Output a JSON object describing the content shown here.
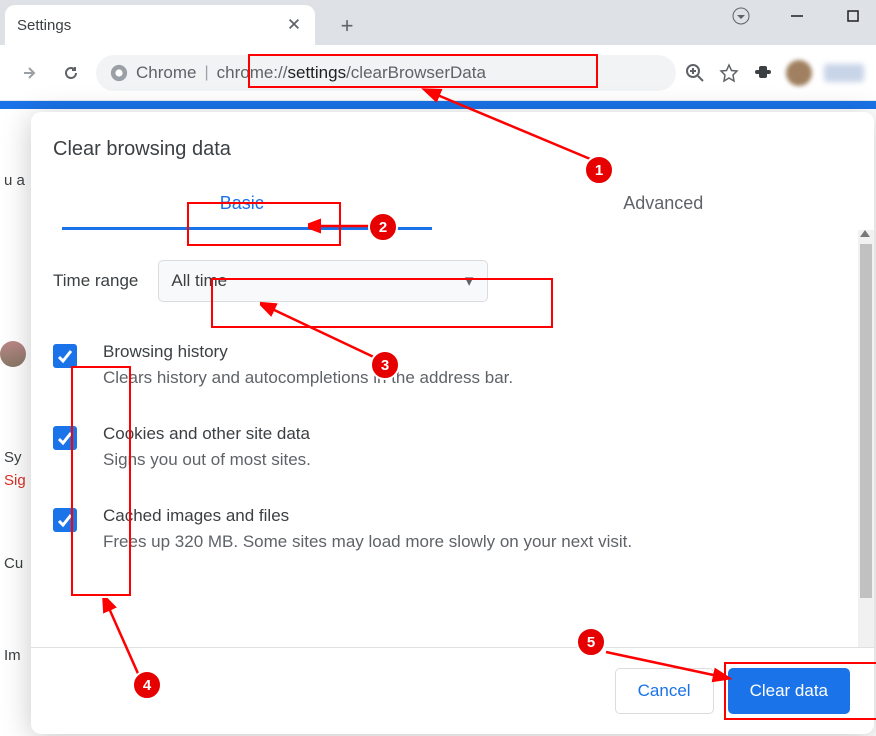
{
  "tab_title": "Settings",
  "url_label": "Chrome",
  "url": "chrome://settings/clearBrowserData",
  "dialog": {
    "title": "Clear browsing data",
    "tabs": {
      "basic": "Basic",
      "advanced": "Advanced"
    },
    "time_range_label": "Time range",
    "time_range_value": "All time",
    "options": [
      {
        "title": "Browsing history",
        "desc": "Clears history and autocompletions in the address bar.",
        "checked": true
      },
      {
        "title": "Cookies and other site data",
        "desc": "Signs you out of most sites.",
        "checked": true
      },
      {
        "title": "Cached images and files",
        "desc": "Frees up 320 MB. Some sites may load more slowly on your next visit.",
        "checked": true
      }
    ],
    "cancel": "Cancel",
    "clear": "Clear data"
  },
  "bg": {
    "l1": "u a",
    "l4": "Sy",
    "l5": "Sig",
    "l6": "Cu",
    "l7": "Im"
  },
  "anno": {
    "c1": "1",
    "c2": "2",
    "c3": "3",
    "c4": "4",
    "c5": "5"
  }
}
